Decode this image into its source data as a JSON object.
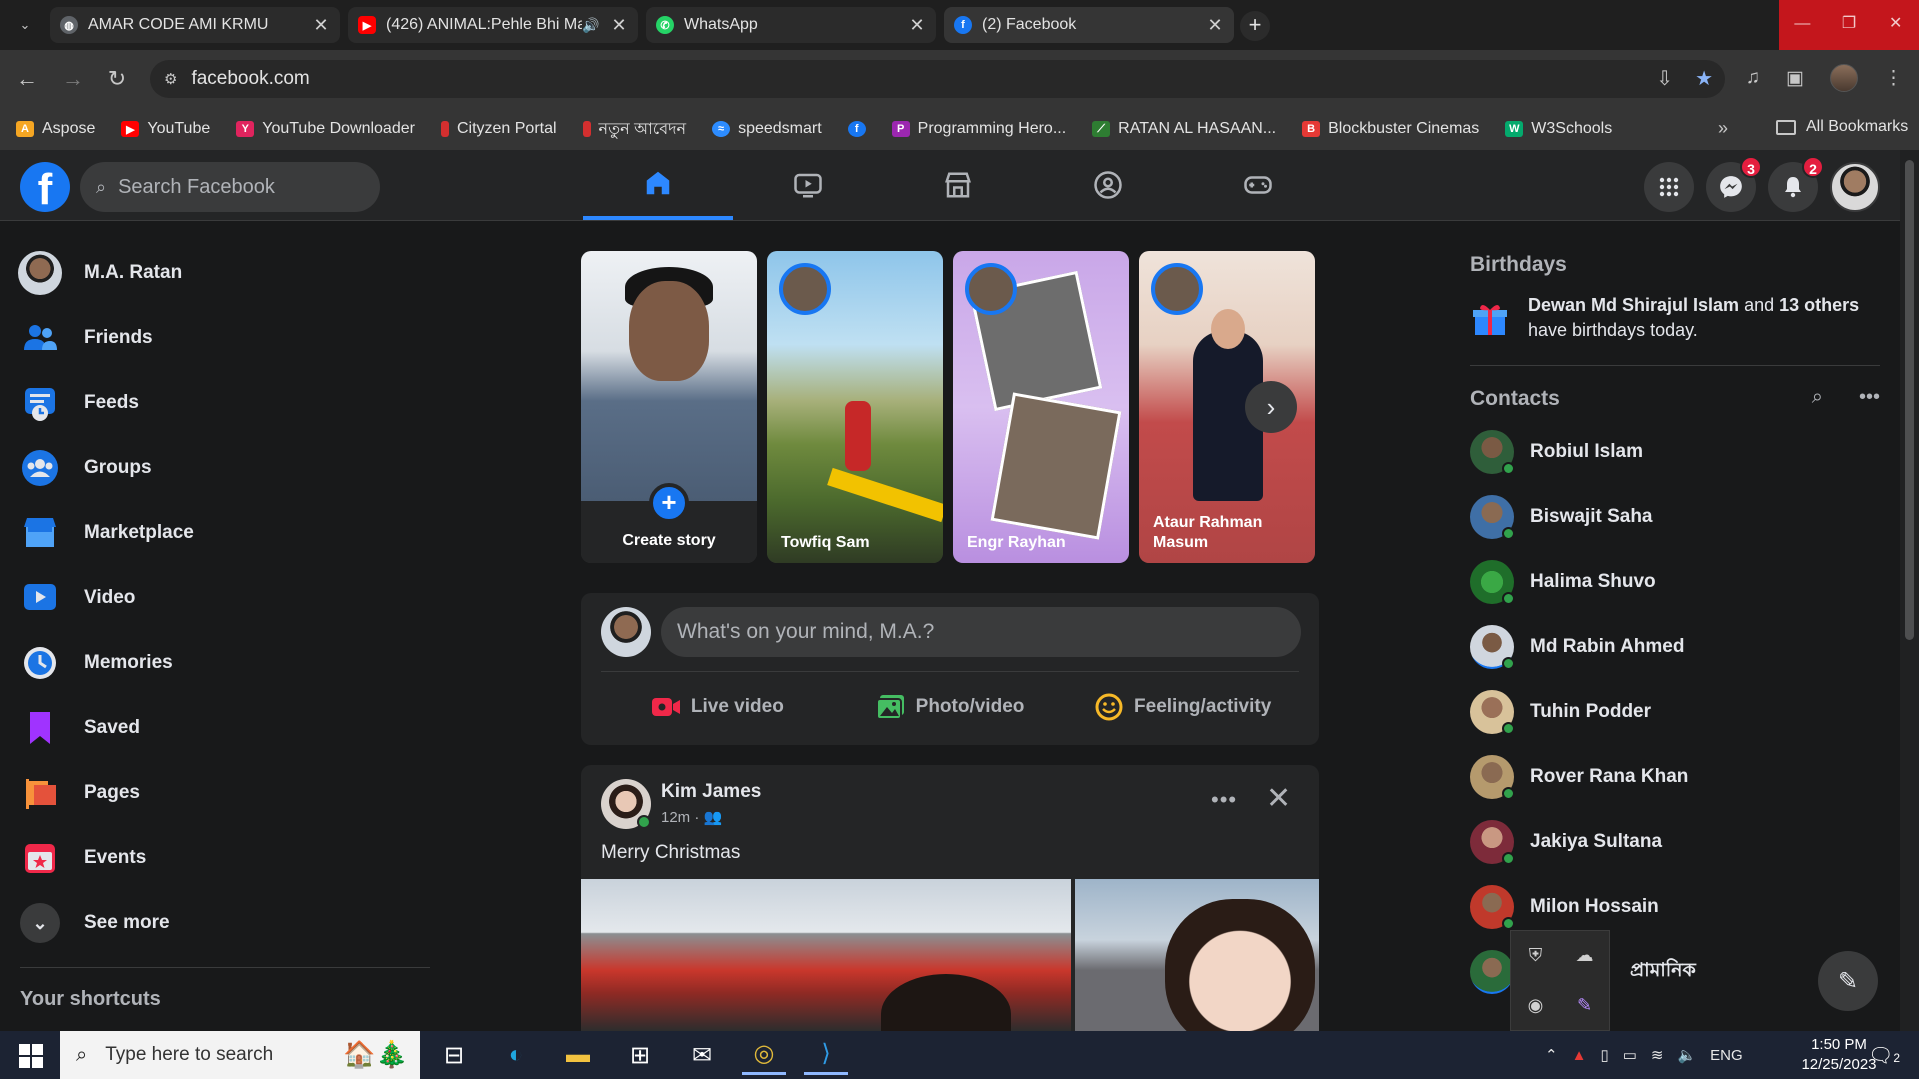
{
  "browser": {
    "tabs": [
      {
        "title": "AMAR CODE AMI KRMU",
        "icon": "globe-icon"
      },
      {
        "title": "(426) ANIMAL:Pehle Bhi Ma",
        "icon": "youtube-icon"
      },
      {
        "title": "WhatsApp",
        "icon": "whatsapp-icon"
      },
      {
        "title": "(2) Facebook",
        "icon": "facebook-icon"
      }
    ],
    "url": "facebook.com",
    "bookmarks": [
      "Aspose",
      "YouTube",
      "YouTube Downloader",
      "Cityzen Portal",
      "নতুন আবেদন",
      "speedsmart",
      "Programming Hero...",
      "RATAN AL HASAAN...",
      "Blockbuster Cinemas",
      "W3Schools"
    ],
    "all_bookmarks": "All Bookmarks"
  },
  "facebook": {
    "search_placeholder": "Search Facebook",
    "messenger_badge": "3",
    "notifications_badge": "2",
    "left_nav": [
      "M.A. Ratan",
      "Friends",
      "Feeds",
      "Groups",
      "Marketplace",
      "Video",
      "Memories",
      "Saved",
      "Pages",
      "Events",
      "See more"
    ],
    "shortcuts_title": "Your shortcuts",
    "stories": [
      {
        "name": "Create story"
      },
      {
        "name": "Towfiq Sam"
      },
      {
        "name": "Engr Rayhan"
      },
      {
        "name": "Ataur Rahman Masum"
      }
    ],
    "composer": {
      "placeholder": "What's on your mind, M.A.?",
      "actions": [
        "Live video",
        "Photo/video",
        "Feeling/activity"
      ]
    },
    "post": {
      "author": "Kim James",
      "time": "12m ·",
      "text": "Merry Christmas"
    },
    "birthdays": {
      "title": "Birthdays",
      "name": "Dewan Md Shirajul Islam",
      "middle": " and ",
      "others": "13 others",
      "suffix": " have birthdays today."
    },
    "contacts_title": "Contacts",
    "contacts": [
      "Robiul Islam",
      "Biswajit Saha",
      "Halima Shuvo",
      "Md Rabin Ahmed",
      "Tuhin Podder",
      "Rover Rana Khan",
      "Jakiya Sultana",
      "Milon Hossain",
      "প্রামানিক"
    ]
  },
  "taskbar": {
    "search_placeholder": "Type here to search",
    "language": "ENG",
    "time": "1:50 PM",
    "date": "12/25/2023",
    "notif_count": "2"
  }
}
